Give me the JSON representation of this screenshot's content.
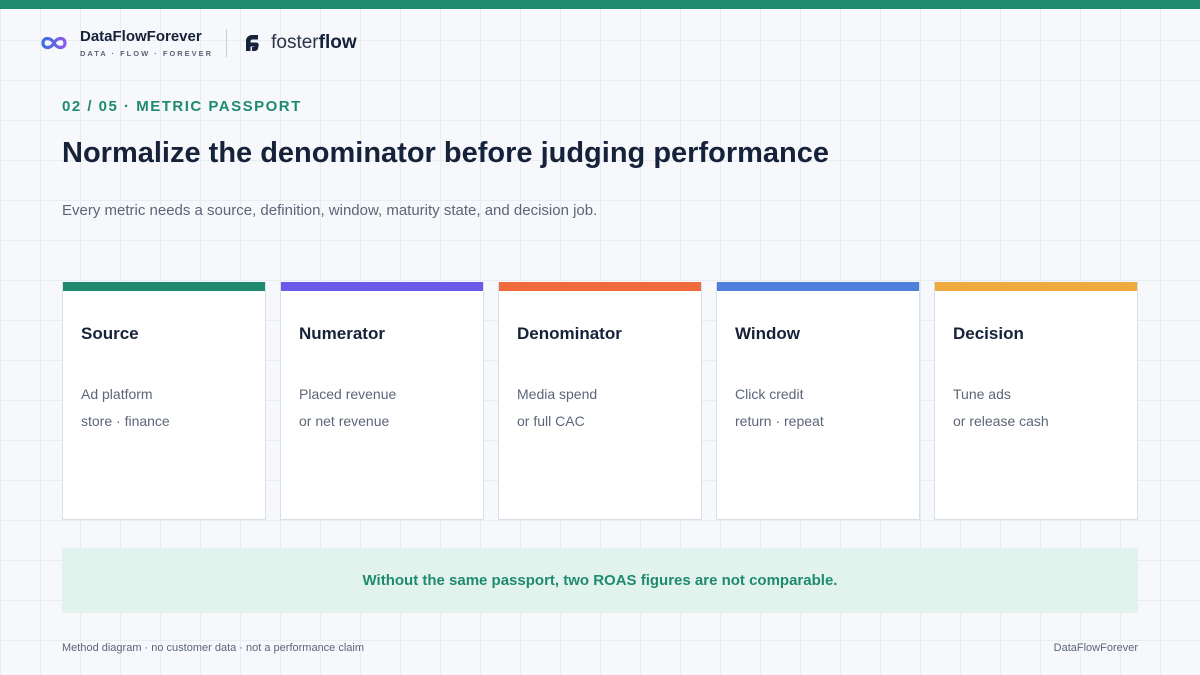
{
  "brand": {
    "name": "DataFlowForever",
    "tagline": "DATA · FLOW · FOREVER",
    "partner_light": "foster",
    "partner_bold": "flow"
  },
  "header": {
    "eyebrow": "02 / 05 · METRIC PASSPORT",
    "title": "Normalize the denominator before judging performance",
    "subtitle": "Every metric needs a source, definition, window, maturity state, and decision job."
  },
  "cards": [
    {
      "title": "Source",
      "line1": "Ad platform",
      "line2": "store · finance",
      "accent": "#1f8a6e"
    },
    {
      "title": "Numerator",
      "line1": "Placed revenue",
      "line2": "or net revenue",
      "accent": "#6b5ae8"
    },
    {
      "title": "Denominator",
      "line1": "Media spend",
      "line2": "or full CAC",
      "accent": "#ef6a3c"
    },
    {
      "title": "Window",
      "line1": "Click credit",
      "line2": "return · repeat",
      "accent": "#4f7fdc"
    },
    {
      "title": "Decision",
      "line1": "Tune ads",
      "line2": "or release cash",
      "accent": "#eeaa3c"
    }
  ],
  "callout": {
    "text": "Without the same passport, two ROAS figures are not comparable."
  },
  "footer": {
    "left": "Method diagram · no customer data · not a performance claim",
    "right": "DataFlowForever"
  },
  "icons": {
    "brand_logo": "infinity-logo-icon",
    "partner_logo": "fosterflow-logo-icon"
  },
  "colors": {
    "accent": "#1f8a6e",
    "callout_bg": "#e2f3ee",
    "title": "#16223a"
  }
}
